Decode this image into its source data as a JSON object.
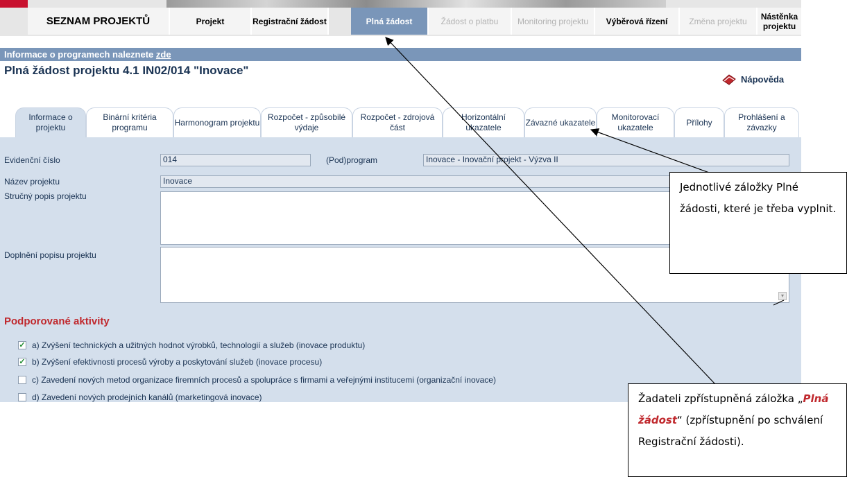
{
  "nav": {
    "seznam": "SEZNAM PROJEKTŮ",
    "tabs": [
      {
        "label": "Projekt"
      },
      {
        "label": "Registrační žádost"
      },
      {
        "label": "Plná žádost"
      },
      {
        "label": "Žádost o platbu"
      },
      {
        "label": "Monitoring projektu"
      },
      {
        "label": "Výběrová řízení"
      },
      {
        "label": "Změna projektu"
      },
      {
        "label": "Nástěnka projektu"
      }
    ]
  },
  "infobar": {
    "text": "Informace o programech naleznete ",
    "link": "zde"
  },
  "page": {
    "title": "Plná žádost projektu 4.1 IN02/014 \"Inovace\"",
    "help": "Nápověda"
  },
  "form_tabs": [
    {
      "label": "Informace o projektu"
    },
    {
      "label": "Binární kritéria programu"
    },
    {
      "label": "Harmonogram projektu"
    },
    {
      "label": "Rozpočet - způsobilé výdaje"
    },
    {
      "label": "Rozpočet - zdrojová část"
    },
    {
      "label": "Horizontální ukazatele"
    },
    {
      "label": "Závazné ukazatele"
    },
    {
      "label": "Monitorovací ukazatele"
    },
    {
      "label": "Přílohy"
    },
    {
      "label": "Prohlášení a závazky"
    }
  ],
  "form": {
    "evidencni_cislo": {
      "label": "Evidenční číslo",
      "value": "014"
    },
    "podprogram": {
      "label": "(Pod)program",
      "value": "Inovace - Inovační projekt - Výzva II"
    },
    "nazev": {
      "label": "Název projektu",
      "value": "Inovace"
    },
    "strucny_popis": {
      "label": "Stručný popis projektu",
      "value": ""
    },
    "doplneni_popisu": {
      "label": "Doplnění popisu projektu",
      "value": ""
    }
  },
  "activities": {
    "title": "Podporované aktivity",
    "items": [
      {
        "label": "a) Zvýšení technických a užitných hodnot výrobků, technologií a služeb (inovace produktu)",
        "checked": true
      },
      {
        "label": "b) Zvýšení efektivnosti procesů výroby a poskytování služeb (inovace procesu)",
        "checked": true
      },
      {
        "label": "c) Zavedení nových metod organizace firemních procesů a spolupráce s firmami a veřejnými institucemi (organizační inovace)",
        "checked": false
      },
      {
        "label": "d) Zavedení nových prodejních kanálů (marketingová inovace)",
        "checked": false
      }
    ]
  },
  "callouts": {
    "tabs": "Jednotlivé záložky Plné žádosti, které je třeba vyplnit.",
    "plna_prefix": "Žadateli zpřístupněná záložka „",
    "plna_bold": "Plná žádost",
    "plna_suffix": "“ (zpřístupnění po schválení Registrační žádosti)."
  },
  "colors": {
    "accent": "#7a96b9",
    "panel": "#d4dfec",
    "title": "#1a3353",
    "red": "#c0282d"
  },
  "icons": {
    "help": "book-help-icon",
    "checkbox_checked": "check-icon"
  }
}
